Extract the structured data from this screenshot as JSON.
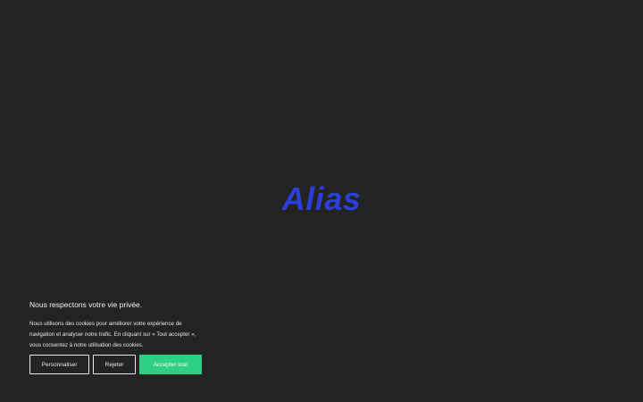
{
  "brand": {
    "logo_text": "Alias",
    "logo_color": "#2b3fd6"
  },
  "cookie_banner": {
    "title": "Nous respectons votre vie privée.",
    "body": "Nous utilisons des cookies pour améliorer votre expérience de navigation et analyser notre trafic. En cliquant sur « Tout accepter », vous consentez à notre utilisation des cookies.",
    "buttons": {
      "personalize_label": "Personnaliser",
      "reject_label": "Rejeter",
      "accept_label": "Accepter tout"
    },
    "accept_color": "#2ed083",
    "accept_text_color": "#ffffff"
  },
  "colors": {
    "background": "#232323"
  }
}
